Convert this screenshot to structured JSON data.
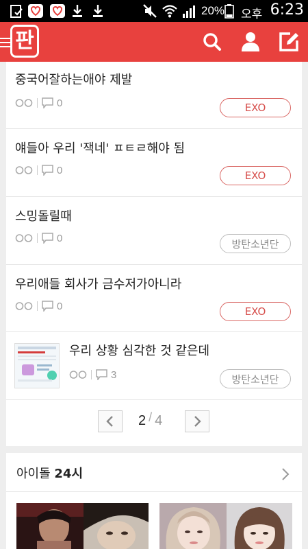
{
  "status_bar": {
    "battery_percent": "20%",
    "ampm": "오후",
    "time": "6:23",
    "icons": [
      "screenshot-icon",
      "heart-notification-icon",
      "heart-notification-icon",
      "download-icon",
      "download-icon",
      "mute-icon",
      "wifi-icon",
      "signal-icon",
      "battery-icon"
    ]
  },
  "header": {
    "logo": "판",
    "icons": [
      "menu-icon",
      "search-icon",
      "profile-icon",
      "write-icon"
    ],
    "color": "#e8413e"
  },
  "posts": [
    {
      "title": "중국어잘하는애야 제발",
      "comments": "0",
      "tag": "EXO",
      "tag_style": "red"
    },
    {
      "title": "얘들아 우리 '잭네' ㅍㅌㄹ해야 됨",
      "comments": "0",
      "tag": "EXO",
      "tag_style": "red"
    },
    {
      "title": "스밍돌릴때",
      "comments": "0",
      "tag": "방탄소년단",
      "tag_style": "gray"
    },
    {
      "title": "우리애들 회사가 금수저가아니라",
      "comments": "0",
      "tag": "EXO",
      "tag_style": "red"
    },
    {
      "title": "우리 상황 심각한 것 같은데",
      "comments": "3",
      "tag": "방탄소년단",
      "tag_style": "gray",
      "has_thumbnail": true
    }
  ],
  "pagination": {
    "current": "2",
    "separator": "/",
    "total": "4"
  },
  "idol_section": {
    "title_prefix": "아이돌 ",
    "title_bold": "24시"
  }
}
